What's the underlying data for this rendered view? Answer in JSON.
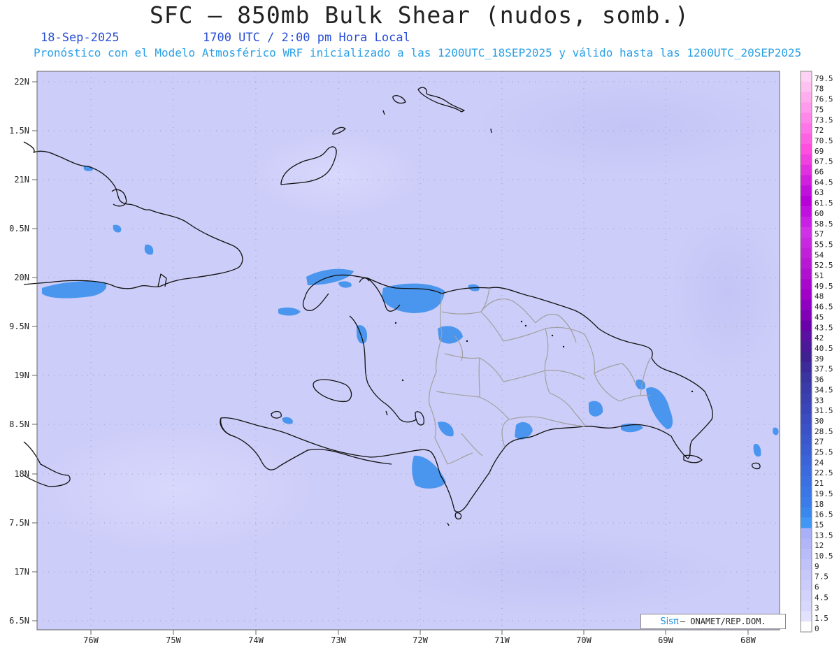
{
  "header": {
    "title": "SFC – 850mb Bulk Shear (nudos, somb.)",
    "date": "18-Sep-2025",
    "time": "1700 UTC / 2:00 pm Hora Local",
    "subtitle": "Pronóstico con el Modelo Atmosférico WRF inicializado a las 1200UTC_18SEP2025 y válido hasta las  1200UTC_20SEP2025"
  },
  "axes": {
    "lat_labels": [
      "22N",
      "1.5N",
      "21N",
      "0.5N",
      "20N",
      "9.5N",
      "19N",
      "8.5N",
      "18N",
      "7.5N",
      "17N",
      "6.5N"
    ],
    "lon_labels": [
      "76W",
      "75W",
      "74W",
      "73W",
      "72W",
      "71W",
      "70W",
      "69W",
      "68W"
    ]
  },
  "colorbar": {
    "labels": [
      "79.5",
      "78",
      "76.5",
      "75",
      "73.5",
      "72",
      "70.5",
      "69",
      "67.5",
      "66",
      "64.5",
      "63",
      "61.5",
      "60",
      "58.5",
      "57",
      "55.5",
      "54",
      "52.5",
      "51",
      "49.5",
      "48",
      "46.5",
      "45",
      "43.5",
      "42",
      "40.5",
      "39",
      "37.5",
      "36",
      "34.5",
      "33",
      "31.5",
      "30",
      "28.5",
      "27",
      "25.5",
      "24",
      "22.5",
      "21",
      "19.5",
      "18",
      "16.5",
      "15",
      "13.5",
      "12",
      "10.5",
      "9",
      "7.5",
      "6",
      "4.5",
      "3",
      "1.5",
      "0"
    ],
    "colors": [
      "#ffd2f5",
      "#ffc0f2",
      "#ffadef",
      "#ff9aec",
      "#ff87e9",
      "#ff74e6",
      "#ff61e3",
      "#ff4ee0",
      "#f040e0",
      "#e030df",
      "#d020de",
      "#c010dc",
      "#b800d8",
      "#c010e0",
      "#c820e4",
      "#d030e8",
      "#c828e0",
      "#c020d8",
      "#b818d4",
      "#b010d0",
      "#a808cc",
      "#a000c8",
      "#9000c0",
      "#8000b8",
      "#6a00a8",
      "#5a10a0",
      "#4a1898",
      "#3e2090",
      "#3c2a98",
      "#3a34a0",
      "#3a3aa8",
      "#3a40b0",
      "#3a46b8",
      "#3a4cc0",
      "#3a52c6",
      "#3a58cc",
      "#3a5ed2",
      "#3a64d8",
      "#3a6ade",
      "#3a70e2",
      "#3a76e6",
      "#3a7cea",
      "#3a88ee",
      "#4098f4",
      "#aab0f8",
      "#b2b6f8",
      "#b8bcf8",
      "#c0c2fa",
      "#c6c8fa",
      "#ccccfa",
      "#d2d2fc",
      "#d8d8fc",
      "#e2e2fe",
      "#ffffff"
    ]
  },
  "credit": {
    "sis": "Sisπ",
    "text": "– ONAMET/REP.DOM."
  }
}
